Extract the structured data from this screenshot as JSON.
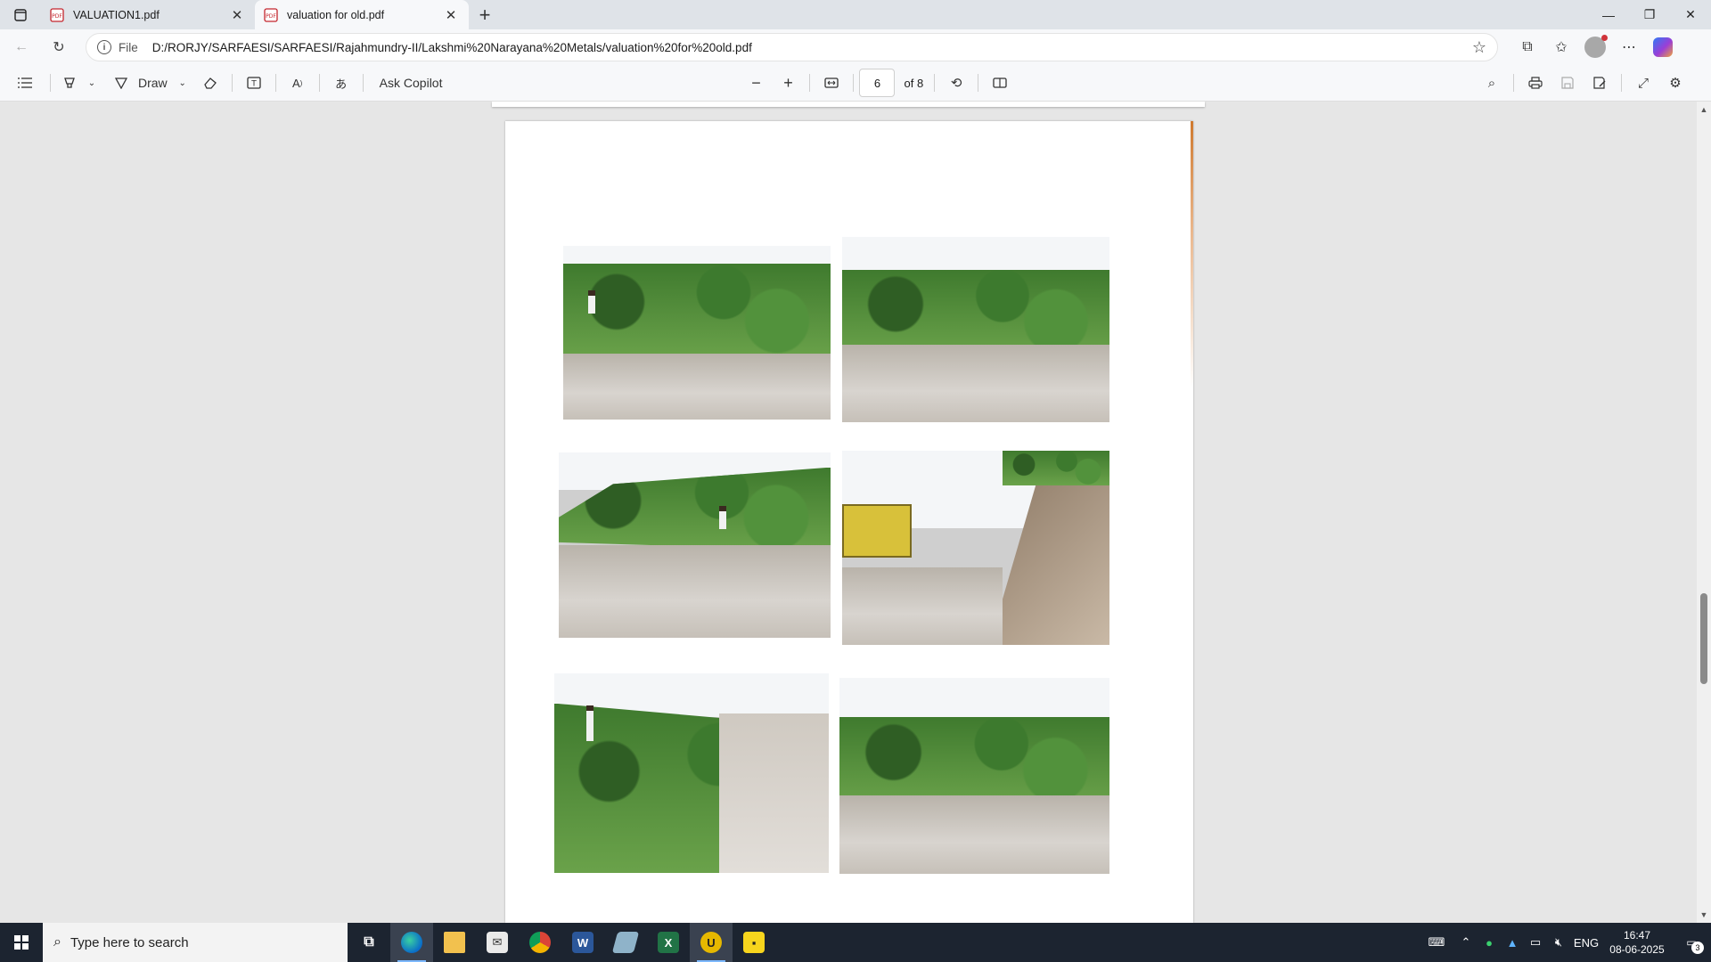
{
  "tabs": [
    {
      "title": "VALUATION1.pdf",
      "active": false
    },
    {
      "title": "valuation for old.pdf",
      "active": true
    }
  ],
  "address": {
    "scheme": "File",
    "url": "D:/RORJY/SARFAESI/SARFAESI/Rajahmundry-II/Lakshmi%20Narayana%20Metals/valuation%20for%20old.pdf"
  },
  "pdf_toolbar": {
    "draw_label": "Draw",
    "copilot_label": "Ask Copilot",
    "page_number": "6",
    "page_total": "of 8"
  },
  "document": {
    "photos": [
      {
        "name": "site-photo-1",
        "scene": "vegetation-road"
      },
      {
        "name": "site-photo-2",
        "scene": "vegetation-road"
      },
      {
        "name": "site-photo-3",
        "scene": "vegetation-road"
      },
      {
        "name": "site-photo-4",
        "scene": "truck-quarry"
      },
      {
        "name": "site-photo-5",
        "scene": "vegetation-path"
      },
      {
        "name": "site-photo-6",
        "scene": "vegetation-road"
      }
    ]
  },
  "taskbar": {
    "search_placeholder": "Type here to search",
    "language": "ENG",
    "time": "16:47",
    "date": "08-06-2025",
    "notification_count": "3"
  },
  "colors": {
    "accent": "#0078d4",
    "taskbar_bg": "#1c2430"
  }
}
